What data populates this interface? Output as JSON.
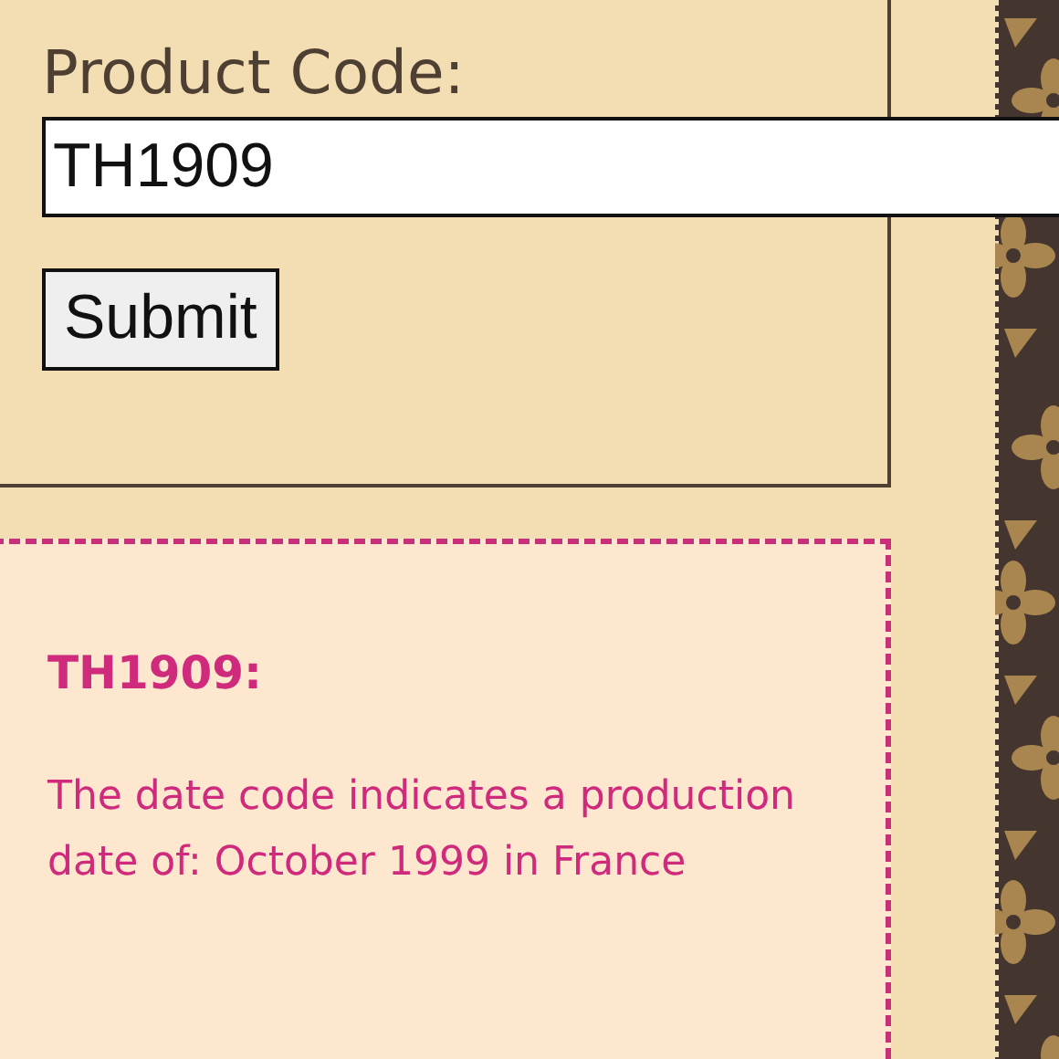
{
  "form": {
    "label": "Product Code:",
    "value": "TH1909",
    "submit": "Submit"
  },
  "result": {
    "title": "TH1909:",
    "text": "The date code indicates a production date of: October 1999 in France"
  }
}
